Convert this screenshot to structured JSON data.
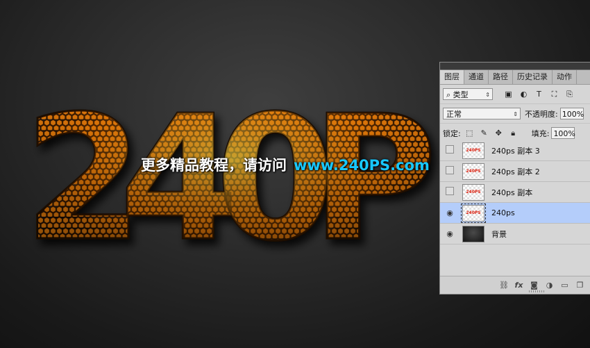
{
  "art": {
    "big_text": "240P",
    "colors": {
      "hex_fill": "#ff9a10",
      "glow": "#ffe040",
      "cell": "#2a1300"
    }
  },
  "watermark": {
    "text": "更多精品教程，请访问",
    "url": "www.240PS.com",
    "url_color": "#18c8ff"
  },
  "panel": {
    "tabs": [
      "图层",
      "通道",
      "路径",
      "历史记录",
      "动作"
    ],
    "active_tab": "图层",
    "filter_label": "类型",
    "filter_icons": [
      "image-filter-icon",
      "adjustment-filter-icon",
      "type-filter-icon",
      "shape-filter-icon",
      "smart-object-filter-icon"
    ],
    "blend_mode": "正常",
    "opacity_label": "不透明度:",
    "opacity_value": "100%",
    "lock_label": "锁定:",
    "fill_label": "填充:",
    "fill_value": "100%",
    "thumb_text": "240PS",
    "layers": [
      {
        "name": "240ps 副本 3",
        "visible": false,
        "selected": false
      },
      {
        "name": "240ps 副本 2",
        "visible": false,
        "selected": false
      },
      {
        "name": "240ps 副本",
        "visible": false,
        "selected": false
      },
      {
        "name": "240ps",
        "visible": true,
        "selected": true
      },
      {
        "name": "背景",
        "visible": true,
        "selected": false
      }
    ],
    "bottom_icons": [
      "link-icon",
      "fx-icon",
      "mask-icon",
      "adjustment-icon",
      "folder-icon",
      "new-layer-icon"
    ]
  }
}
